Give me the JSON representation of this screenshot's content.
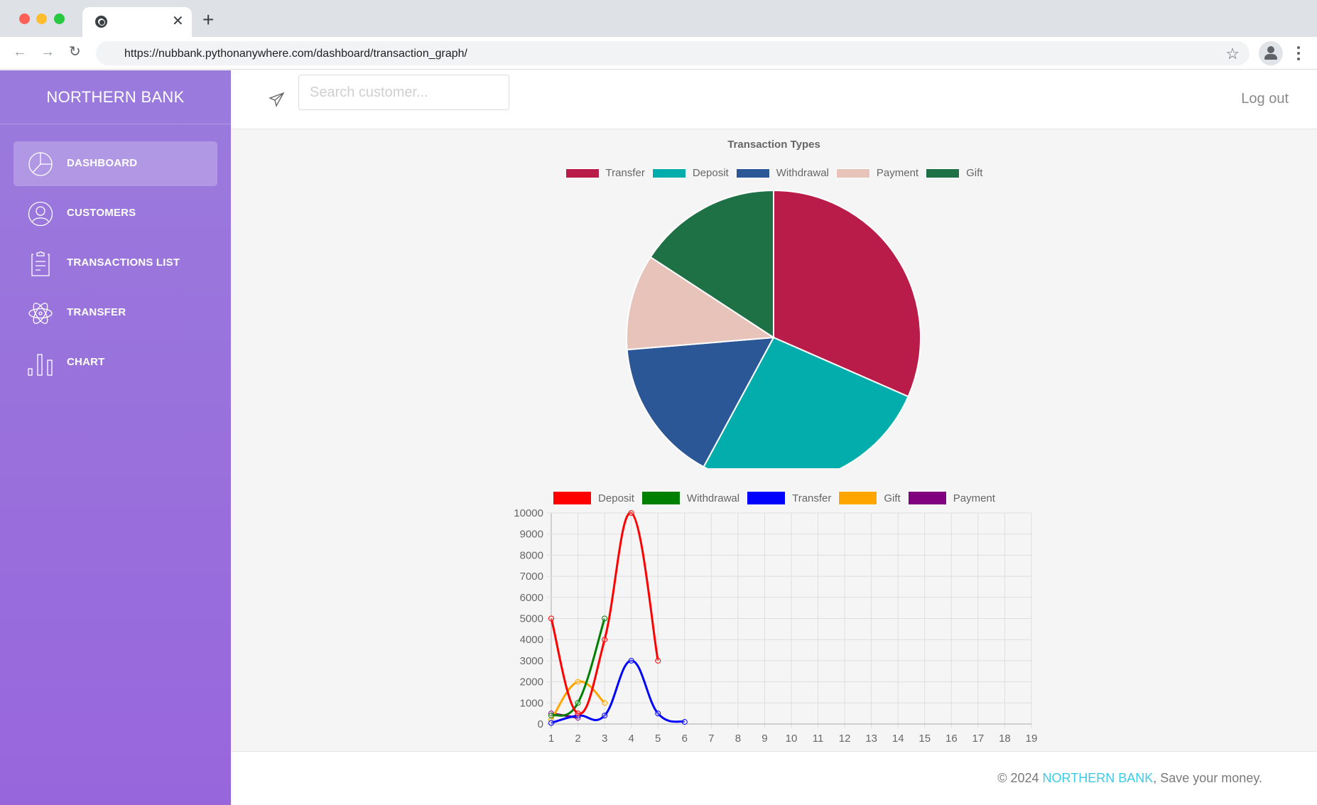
{
  "browser": {
    "tab_close": "✕",
    "new_tab": "+",
    "back": "←",
    "forward": "→",
    "reload": "↻",
    "url": "https://nubbank.pythonanywhere.com/dashboard/transaction_graph/",
    "bookmark": "☆"
  },
  "sidebar": {
    "brand": "NORTHERN BANK",
    "items": [
      {
        "label": "DASHBOARD",
        "icon": "pie-chart-icon",
        "active": true
      },
      {
        "label": "CUSTOMERS",
        "icon": "user-icon",
        "active": false
      },
      {
        "label": "TRANSACTIONS LIST",
        "icon": "clipboard-icon",
        "active": false
      },
      {
        "label": "TRANSFER",
        "icon": "atom-icon",
        "active": false
      },
      {
        "label": "CHART",
        "icon": "bar-chart-icon",
        "active": false
      }
    ]
  },
  "header": {
    "search_placeholder": "Search customer...",
    "search_value": "",
    "logout": "Log out"
  },
  "chart_data": [
    {
      "type": "pie",
      "title": "Transaction Types",
      "legend_position": "top",
      "categories": [
        "Transfer",
        "Deposit",
        "Withdrawal",
        "Payment",
        "Gift"
      ],
      "values": [
        6,
        5,
        3,
        2,
        3
      ],
      "colors": [
        "#b91c48",
        "#03adab",
        "#2b5797",
        "#e8c3b9",
        "#1e7145"
      ]
    },
    {
      "type": "line",
      "title": "",
      "legend_position": "top",
      "x": [
        1,
        2,
        3,
        4,
        5,
        6,
        7,
        8,
        9,
        10,
        11,
        12,
        13,
        14,
        15,
        16,
        17,
        18,
        19
      ],
      "xlabel": "",
      "ylabel": "",
      "ylim": [
        0,
        10000
      ],
      "yticks": [
        0,
        1000,
        2000,
        3000,
        4000,
        5000,
        6000,
        7000,
        8000,
        9000,
        10000
      ],
      "grid": true,
      "series": [
        {
          "name": "Deposit",
          "color": "#ff0000",
          "values": [
            5000,
            500,
            4000,
            10000,
            3000
          ]
        },
        {
          "name": "Withdrawal",
          "color": "#008000",
          "values": [
            400,
            1000,
            5000
          ]
        },
        {
          "name": "Transfer",
          "color": "#0000ff",
          "values": [
            50,
            400,
            400,
            3000,
            500,
            100
          ]
        },
        {
          "name": "Gift",
          "color": "#ffa500",
          "values": [
            200,
            2000,
            1000
          ]
        },
        {
          "name": "Payment",
          "color": "#800080",
          "values": [
            500,
            300
          ]
        }
      ]
    }
  ],
  "footer": {
    "copyright": "© 2024 ",
    "brand_link": "NORTHERN BANK",
    "tagline": ", Save your money."
  }
}
